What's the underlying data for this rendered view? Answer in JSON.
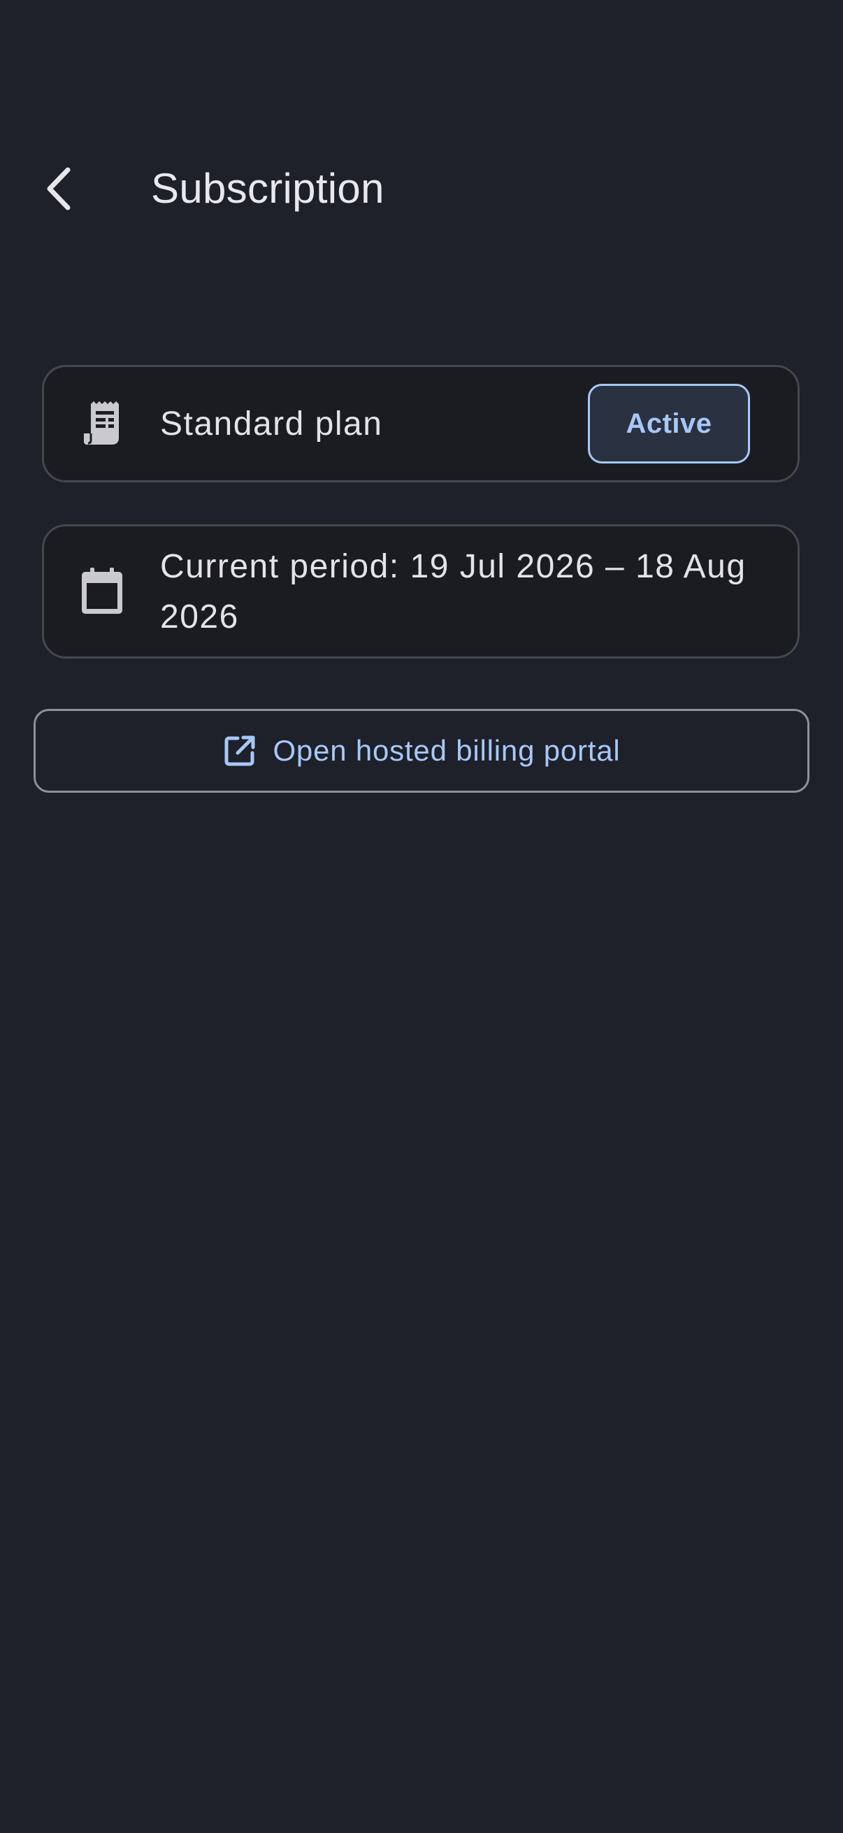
{
  "header": {
    "title": "Subscription",
    "back_icon": "chevron-left-icon"
  },
  "plan_card": {
    "icon": "receipt-icon",
    "label": "Standard plan",
    "status": "Active"
  },
  "period_card": {
    "icon": "calendar-icon",
    "label": "Current period: 19 Jul 2026 – 18 Aug 2026"
  },
  "portal_button": {
    "icon": "open-in-new-icon",
    "label": "Open hosted billing portal"
  },
  "colors": {
    "background": "#1e202a",
    "card_background": "#1b1c21",
    "card_border": "#45474e",
    "accent": "#a7c8f6",
    "text": "#e3e3e8"
  }
}
